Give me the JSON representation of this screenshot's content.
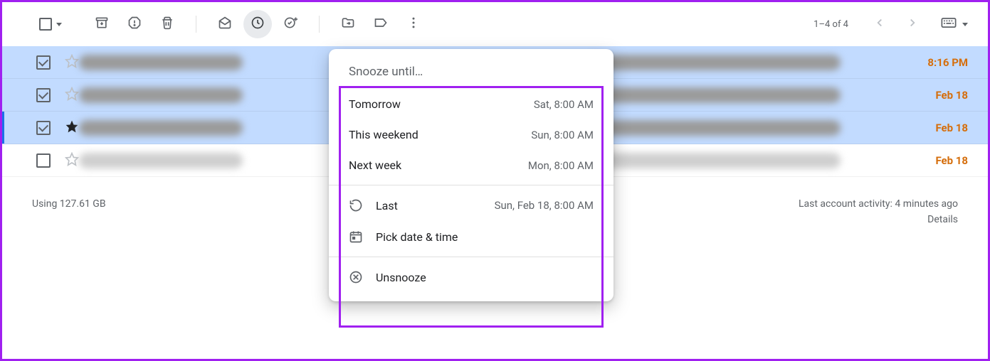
{
  "toolbar": {
    "pager_text": "1–4 of 4"
  },
  "rows": [
    {
      "time": "8:16 PM"
    },
    {
      "time": "Feb 18"
    },
    {
      "time": "Feb 18"
    },
    {
      "time": "Feb 18"
    }
  ],
  "footer": {
    "storage": "Using 127.61 GB",
    "activity": "Last account activity: 4 minutes ago",
    "details": "Details"
  },
  "snooze": {
    "title": "Snooze until…",
    "options": [
      {
        "label": "Tomorrow",
        "detail": "Sat, 8:00 AM"
      },
      {
        "label": "This weekend",
        "detail": "Sun, 8:00 AM"
      },
      {
        "label": "Next week",
        "detail": "Mon, 8:00 AM"
      }
    ],
    "last_label": "Last",
    "last_detail": "Sun, Feb 18, 8:00 AM",
    "pick_label": "Pick date & time",
    "unsnooze_label": "Unsnooze"
  }
}
